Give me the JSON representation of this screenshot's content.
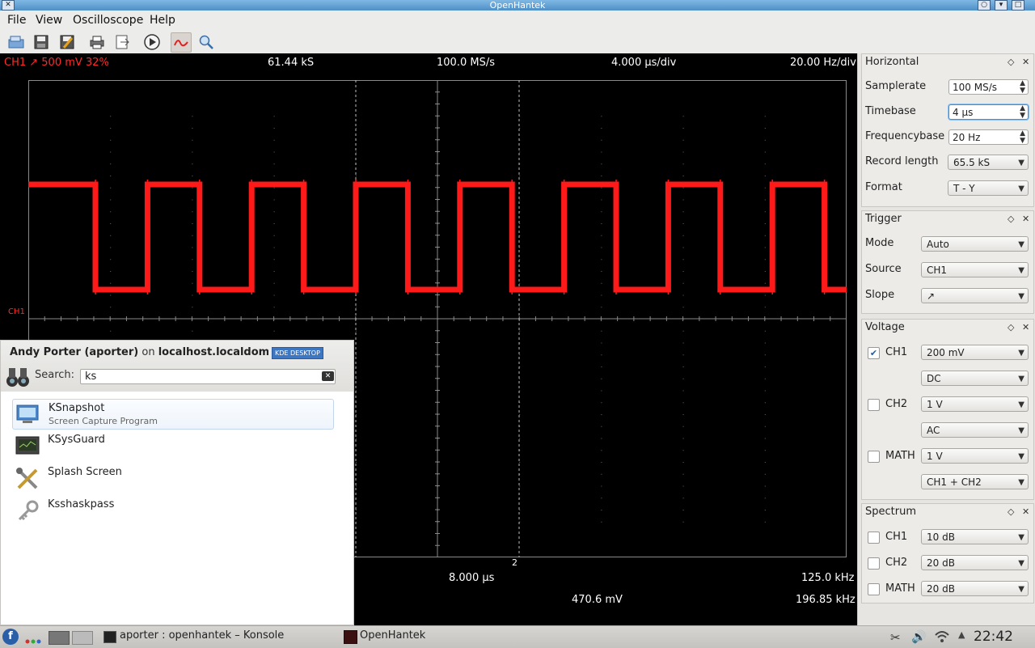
{
  "window": {
    "title": "OpenHantek"
  },
  "menu": {
    "file": "File",
    "view": "View",
    "oscilloscope": "Oscilloscope",
    "help": "Help"
  },
  "scope": {
    "channel_status": "CH1  ↗  500 mV  32%",
    "samples": "61.44 kS",
    "samplerate": "100.0 MS/s",
    "timebase": "4.000 µs/div",
    "freqbase": "20.00 Hz/div",
    "ch1_marker": "CH1",
    "marker2": "2",
    "measure_time": "8.000 µs",
    "measure_freq": "125.0 kHz",
    "measure_amp": "470.6 mV",
    "measure_freq2": "196.85 kHz",
    "trace_color": "#ff1a1a"
  },
  "horizontal": {
    "title": "Horizontal",
    "samplerate_label": "Samplerate",
    "samplerate": "100 MS/s",
    "timebase_label": "Timebase",
    "timebase": "4 µs",
    "frequencybase_label": "Frequencybase",
    "frequencybase": "20 Hz",
    "record_length_label": "Record length",
    "record_length": "65.5 kS",
    "format_label": "Format",
    "format": "T - Y"
  },
  "trigger": {
    "title": "Trigger",
    "mode_label": "Mode",
    "mode": "Auto",
    "source_label": "Source",
    "source": "CH1",
    "slope_label": "Slope",
    "slope": "↗"
  },
  "voltage": {
    "title": "Voltage",
    "ch1_label": "CH1",
    "ch1_value": "200 mV",
    "ch1_coupling": "DC",
    "ch1_checked": true,
    "ch2_label": "CH2",
    "ch2_value": "1 V",
    "ch2_coupling": "AC",
    "ch2_checked": false,
    "math_label": "MATH",
    "math_value": "1 V",
    "math_mode": "CH1 + CH2",
    "math_checked": false
  },
  "spectrum": {
    "title": "Spectrum",
    "ch1_label": "CH1",
    "ch1_value": "10 dB",
    "ch2_label": "CH2",
    "ch2_value": "20 dB",
    "math_label": "MATH",
    "math_value": "20 dB"
  },
  "launcher": {
    "user": "Andy Porter (aporter)",
    "on": "on",
    "host": "localhost.localdom",
    "kde_badge": "KDE DESKTOP",
    "search_label": "Search:",
    "search_value": "ks",
    "results": [
      {
        "name": "KSnapshot",
        "desc": "Screen Capture Program",
        "icon": "camera-icon"
      },
      {
        "name": "KSysGuard",
        "desc": "",
        "icon": "monitor-icon"
      },
      {
        "name": "Splash Screen",
        "desc": "",
        "icon": "tools-icon"
      },
      {
        "name": "Ksshaskpass",
        "desc": "",
        "icon": "key-icon"
      }
    ]
  },
  "taskbar": {
    "konsole": "aporter : openhantek – Konsole",
    "openhantek": "OpenHantek",
    "clock": "22:42"
  }
}
